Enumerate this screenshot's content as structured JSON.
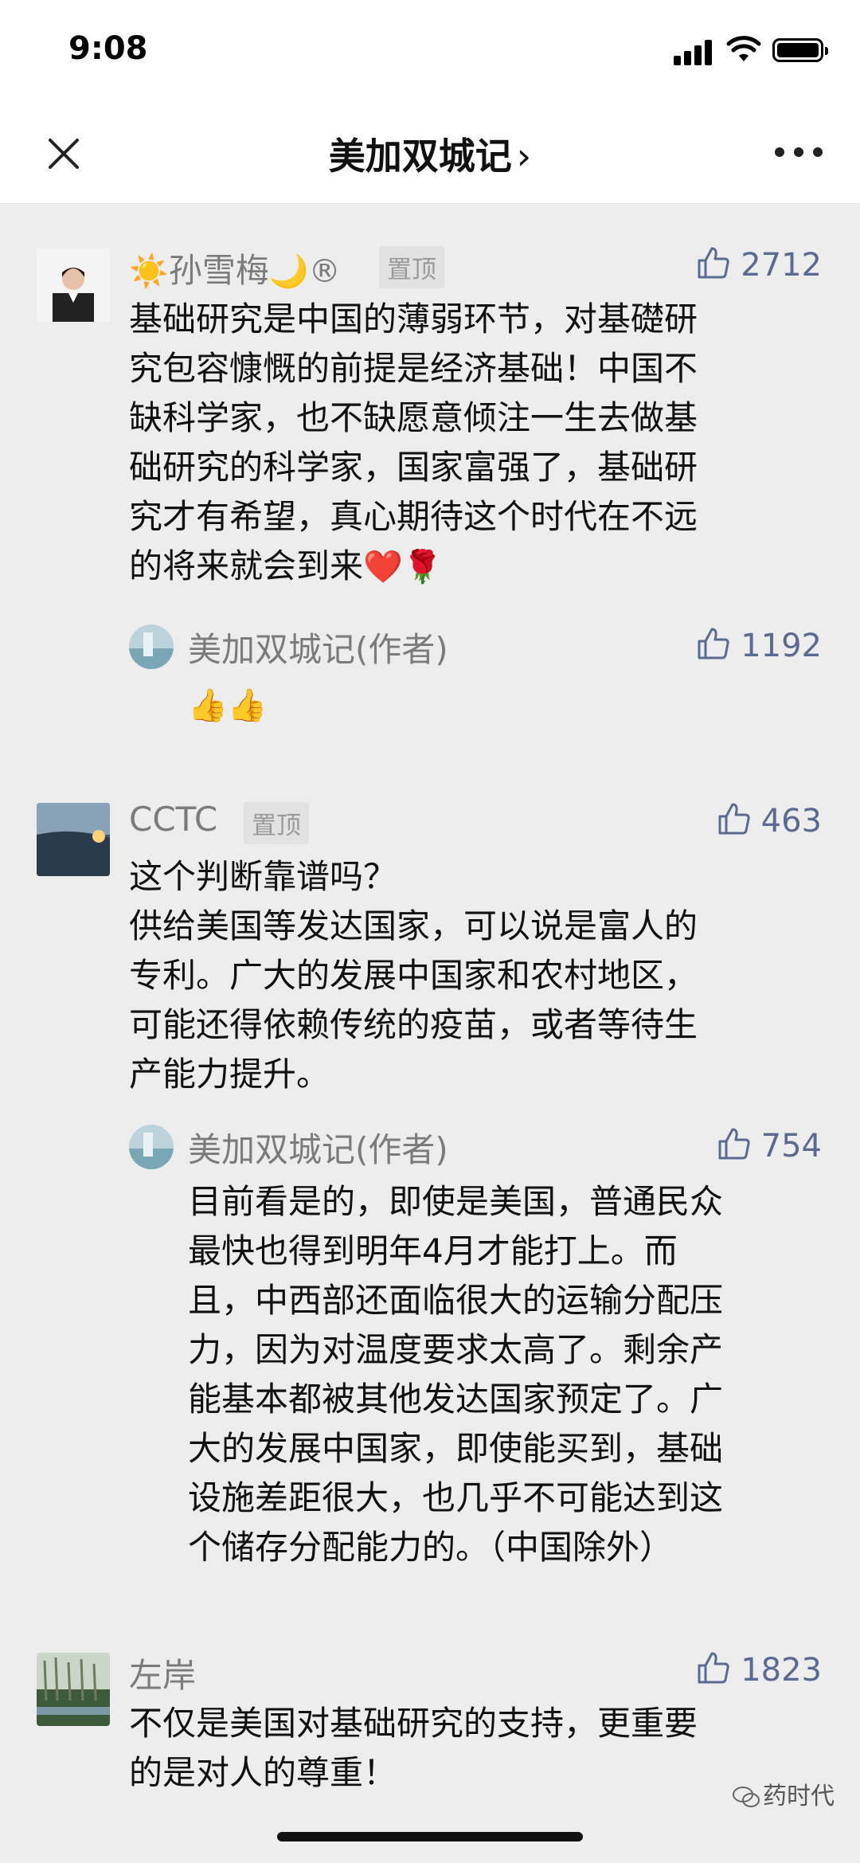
{
  "status": {
    "time": "9:08"
  },
  "nav": {
    "title": "美加双城记",
    "chevron": "›"
  },
  "comments": [
    {
      "name": "孙雪梅",
      "name_prefix": "☀️",
      "name_suffix": "🌙®",
      "pin": "置顶",
      "likes": "2712",
      "lines": [
        "基础研究是中国的薄弱环节，对基礎研",
        "究包容慷慨的前提是经济基础！中国不",
        "缺科学家，也不缺愿意倾注一生去做基",
        "础研究的科学家，国家富强了，基础研",
        "究才有希望，真心期待这个时代在不远",
        "的将来就会到来"
      ],
      "line_end_emoji": "❤️🌹",
      "reply": {
        "name": "美加双城记(作者)",
        "likes": "1192",
        "text": "👍👍"
      }
    },
    {
      "name": "CCTC",
      "pin": "置顶",
      "likes": "463",
      "lines": [
        "这个判断靠谱吗？",
        "供给美国等发达国家，可以说是富人的",
        "专利。广大的发展中国家和农村地区，",
        "可能还得依赖传统的疫苗，或者等待生",
        "产能力提升。"
      ],
      "reply": {
        "name": "美加双城记(作者)",
        "likes": "754",
        "lines": [
          "目前看是的，即使是美国，普通民众",
          "最快也得到明年4月才能打上。而",
          "且，中西部还面临很大的运输分配压",
          "力，因为对温度要求太高了。剩余产",
          "能基本都被其他发达国家预定了。广",
          "大的发展中国家，即使能买到，基础",
          "设施差距很大，也几乎不可能达到这",
          "个储存分配能力的。（中国除外）"
        ]
      }
    },
    {
      "name": "左岸",
      "likes": "1823",
      "lines": [
        "不仅是美国对基础研究的支持，更重要",
        "的是对人的尊重！"
      ]
    }
  ],
  "watermark": "药时代",
  "colors": {
    "background": "#ededed",
    "like_blue": "#5b6a91",
    "name_gray": "#7b7b7b"
  }
}
